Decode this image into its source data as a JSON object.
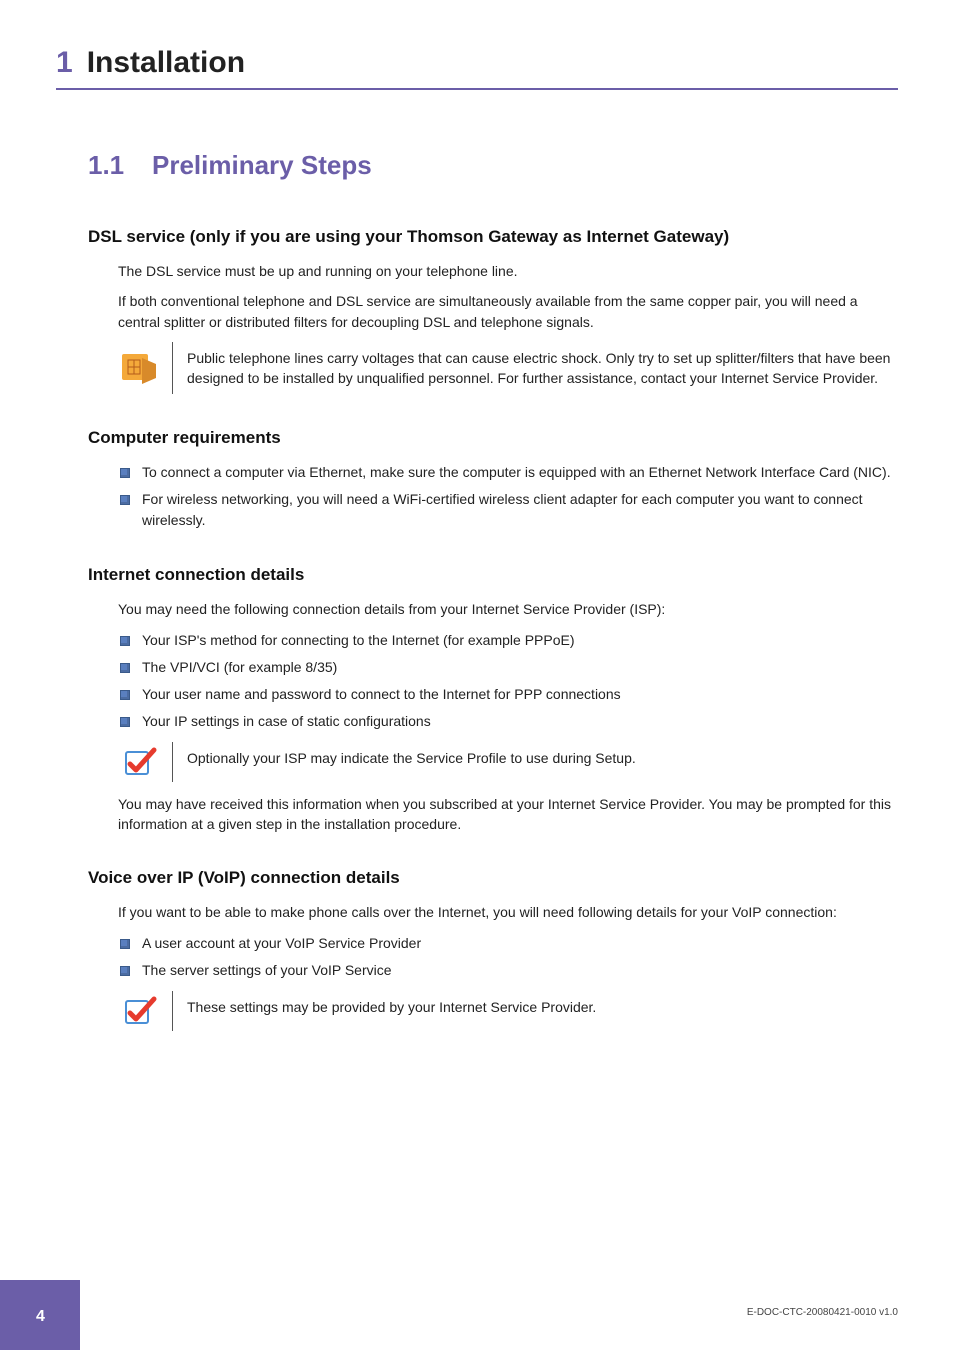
{
  "chapter": {
    "num": "1",
    "title": "Installation"
  },
  "section": {
    "num": "1.1",
    "title": "Preliminary Steps"
  },
  "dsl": {
    "heading": "DSL service (only if you are using your Thomson Gateway as Internet Gateway)",
    "p1": "The DSL service must be up and running on your telephone line.",
    "p2": "If both conventional telephone and DSL service are simultaneously available from the same copper pair, you will need a central splitter or distributed filters for decoupling DSL and telephone signals.",
    "warn": "Public telephone lines carry voltages that can cause electric shock. Only try to set up splitter/filters that have been designed to be installed by unqualified personnel. For further assistance, contact your Internet Service Provider."
  },
  "comp": {
    "heading": "Computer requirements",
    "items": [
      "To connect a computer via Ethernet, make sure the computer is equipped with an Ethernet Network Interface Card (NIC).",
      "For wireless networking, you will need a WiFi-certified wireless client adapter for each computer you want to connect wirelessly."
    ]
  },
  "inet": {
    "heading": "Internet connection details",
    "intro": "You may need the following connection details from your Internet Service Provider (ISP):",
    "items": [
      "Your ISP's method for connecting to the Internet (for example PPPoE)",
      "The VPI/VCI (for example 8/35)",
      "Your user name and password to connect to the Internet for PPP connections",
      "Your IP settings in case of static configurations"
    ],
    "note": "Optionally your ISP may indicate the Service Profile to use during Setup.",
    "outro": "You may have received this information when you subscribed at your Internet Service Provider. You may be prompted for this information at a given step in the installation procedure."
  },
  "voip": {
    "heading": "Voice over IP (VoIP) connection details",
    "intro": "If you want to be able to make phone calls over the Internet, you will need following details for your VoIP connection:",
    "items": [
      "A user account at your VoIP Service Provider",
      "The server settings of your VoIP Service"
    ],
    "note": "These settings may be provided by your Internet Service Provider."
  },
  "footer": {
    "page": "4",
    "docid": "E-DOC-CTC-20080421-0010 v1.0"
  }
}
